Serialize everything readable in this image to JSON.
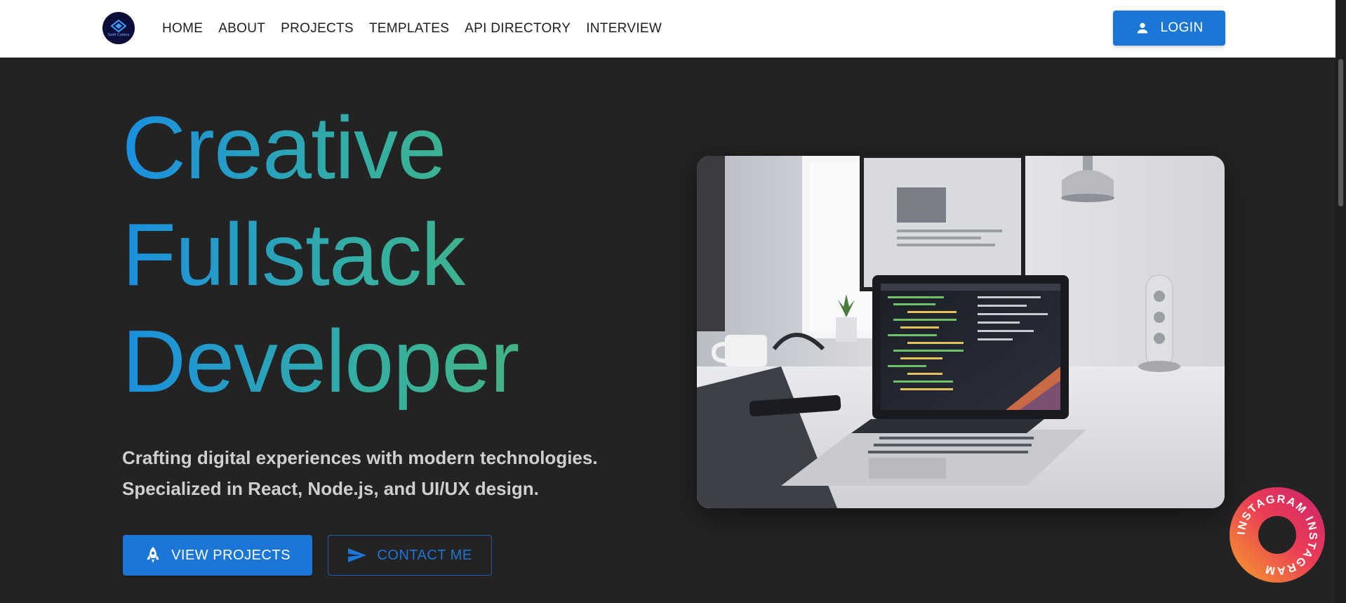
{
  "header": {
    "logo_text": "Swift Coders",
    "nav": [
      "HOME",
      "ABOUT",
      "PROJECTS",
      "TEMPLATES",
      "API DIRECTORY",
      "INTERVIEW"
    ],
    "login_label": "LOGIN",
    "login_icon": "person-icon"
  },
  "hero": {
    "title_lines": [
      "Creative",
      "Fullstack",
      "Developer"
    ],
    "subtitle_lines": [
      "Crafting digital experiences with modern technologies.",
      "Specialized in React, Node.js, and UI/UX design."
    ],
    "primary_button": {
      "label": "VIEW PROJECTS",
      "icon": "rocket-icon"
    },
    "secondary_button": {
      "label": "CONTACT ME",
      "icon": "send-icon"
    },
    "image_icon": "developer-desk-photo"
  },
  "badge": {
    "text": "INSTAGRAM INSTAGRAM",
    "icon": "instagram-badge"
  },
  "colors": {
    "accent": "#1b76d6",
    "background": "#232323",
    "header_bg": "#ffffff",
    "gradient_start": "#1a8fe0",
    "gradient_end": "#46b380",
    "subtitle": "#cfcfcf"
  }
}
